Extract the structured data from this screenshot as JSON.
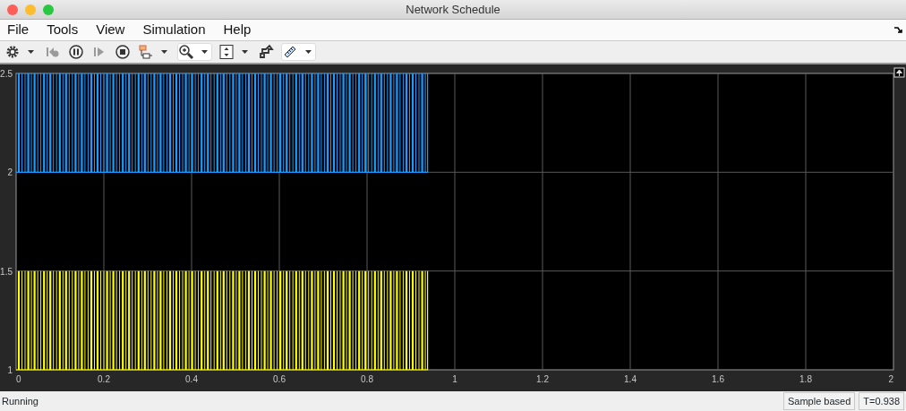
{
  "window": {
    "title": "Network Schedule"
  },
  "menu": [
    "File",
    "Tools",
    "View",
    "Simulation",
    "Help"
  ],
  "toolbar": [
    {
      "kind": "settings",
      "dropdown": true,
      "disabled": false,
      "selected": false
    },
    {
      "kind": "step-back",
      "dropdown": false,
      "disabled": true,
      "selected": false
    },
    {
      "kind": "pause",
      "dropdown": false,
      "disabled": false,
      "selected": false
    },
    {
      "kind": "step-forward",
      "dropdown": false,
      "disabled": true,
      "selected": false
    },
    {
      "kind": "stop",
      "dropdown": false,
      "disabled": false,
      "selected": false
    },
    {
      "kind": "signal-selector",
      "dropdown": true,
      "disabled": false,
      "selected": false
    },
    {
      "kind": "zoom",
      "dropdown": true,
      "disabled": false,
      "selected": true
    },
    {
      "kind": "fit",
      "dropdown": true,
      "disabled": false,
      "selected": false
    },
    {
      "kind": "highlight",
      "dropdown": false,
      "disabled": false,
      "selected": false
    },
    {
      "kind": "measure",
      "dropdown": true,
      "disabled": false,
      "selected": true
    }
  ],
  "plot": {
    "y_ticks": [
      "2.5",
      "2",
      "1.5",
      "1"
    ],
    "x_ticks": [
      "0",
      "0.2",
      "0.4",
      "0.6",
      "0.8",
      "1",
      "1.2",
      "1.4",
      "1.6",
      "1.8",
      "2"
    ],
    "traces": [
      {
        "color": "#1a9bff"
      },
      {
        "color": "#ffff00"
      }
    ]
  },
  "status_bar": {
    "state": "Running",
    "mode": "Sample based",
    "time": "T=0.938"
  }
}
